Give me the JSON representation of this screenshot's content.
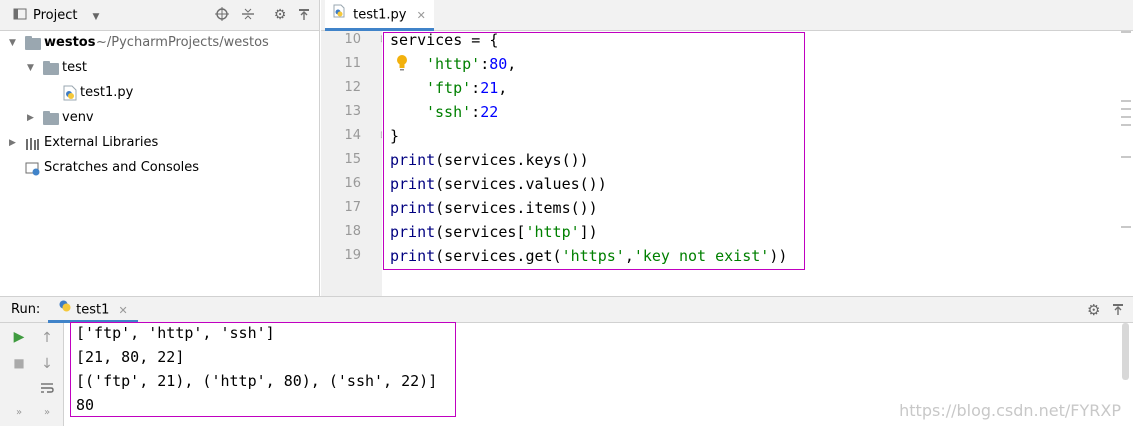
{
  "project_panel": {
    "title": "Project",
    "tree": [
      {
        "label": "westos",
        "hint": " ~/PycharmProjects/westos"
      },
      {
        "label": "test"
      },
      {
        "label": "test1.py"
      },
      {
        "label": "venv"
      },
      {
        "label": "External Libraries"
      },
      {
        "label": "Scratches and Consoles"
      }
    ]
  },
  "editor": {
    "tab_label": "test1.py",
    "line_numbers": [
      "10",
      "11",
      "12",
      "13",
      "14",
      "15",
      "16",
      "17",
      "18",
      "19"
    ],
    "lines": [
      [
        "services = {"
      ],
      [
        "'http'",
        ":",
        "80",
        ","
      ],
      [
        "'ftp'",
        ":",
        "21",
        ","
      ],
      [
        "'ssh'",
        ":",
        "22"
      ],
      [
        "}"
      ],
      [
        "print",
        "(services.keys())"
      ],
      [
        "print",
        "(services.values())"
      ],
      [
        "print",
        "(services.items())"
      ],
      [
        "print",
        "(services[",
        "'http'",
        "])"
      ],
      [
        "print",
        "(services.get(",
        "'https'",
        ",",
        "'key not exist'",
        "))"
      ]
    ]
  },
  "run_panel": {
    "label": "Run:",
    "tab_label": "test1",
    "output": [
      "['ftp', 'http', 'ssh']",
      "[21, 80, 22]",
      "[('ftp', 21), ('http', 80), ('ssh', 22)]",
      "80"
    ]
  },
  "watermark": "https://blog.csdn.net/FYRXP",
  "colors": {
    "accent": "#4083c9",
    "highlight_box": "#c000c0",
    "string": "#008000",
    "number": "#0000ff",
    "keyword": "#000080"
  }
}
